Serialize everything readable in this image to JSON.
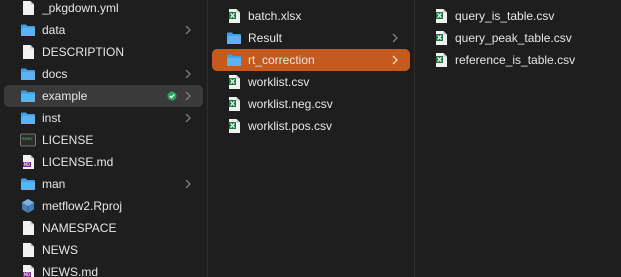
{
  "columns": [
    {
      "items": [
        {
          "label": "_pkgdown.yml",
          "icon": "document-icon",
          "folder": false
        },
        {
          "label": "data",
          "icon": "folder-icon",
          "folder": true
        },
        {
          "label": "DESCRIPTION",
          "icon": "document-icon",
          "folder": false
        },
        {
          "label": "docs",
          "icon": "folder-icon",
          "folder": true
        },
        {
          "label": "example",
          "icon": "folder-icon",
          "folder": true,
          "selected": "inactive",
          "badge": "synced-check-icon"
        },
        {
          "label": "inst",
          "icon": "folder-icon",
          "folder": true
        },
        {
          "label": "LICENSE",
          "icon": "terminal-exec-icon",
          "folder": false
        },
        {
          "label": "LICENSE.md",
          "icon": "markdown-icon",
          "folder": false
        },
        {
          "label": "man",
          "icon": "folder-icon",
          "folder": true
        },
        {
          "label": "metflow2.Rproj",
          "icon": "rproj-icon",
          "folder": false
        },
        {
          "label": "NAMESPACE",
          "icon": "document-icon",
          "folder": false
        },
        {
          "label": "NEWS",
          "icon": "document-icon",
          "folder": false
        },
        {
          "label": "NEWS.md",
          "icon": "markdown-icon",
          "folder": false
        }
      ]
    },
    {
      "items": [
        {
          "label": "batch.xlsx",
          "icon": "excel-icon",
          "folder": false
        },
        {
          "label": "Result",
          "icon": "folder-icon",
          "folder": true
        },
        {
          "label": "rt_correction",
          "icon": "folder-icon",
          "folder": true,
          "selected": "active"
        },
        {
          "label": "worklist.csv",
          "icon": "excel-icon",
          "folder": false
        },
        {
          "label": "worklist.neg.csv",
          "icon": "excel-icon",
          "folder": false
        },
        {
          "label": "worklist.pos.csv",
          "icon": "excel-icon",
          "folder": false
        }
      ]
    },
    {
      "items": [
        {
          "label": "query_is_table.csv",
          "icon": "excel-icon",
          "folder": false
        },
        {
          "label": "query_peak_table.csv",
          "icon": "excel-icon",
          "folder": false
        },
        {
          "label": "reference_is_table.csv",
          "icon": "excel-icon",
          "folder": false
        }
      ]
    }
  ],
  "colors": {
    "background": "#1e1e1e",
    "selection_active": "#c45a1e",
    "selection_inactive": "#3a3a3a",
    "folder": "#3d9fe6",
    "excel_green": "#1d7a3f"
  }
}
